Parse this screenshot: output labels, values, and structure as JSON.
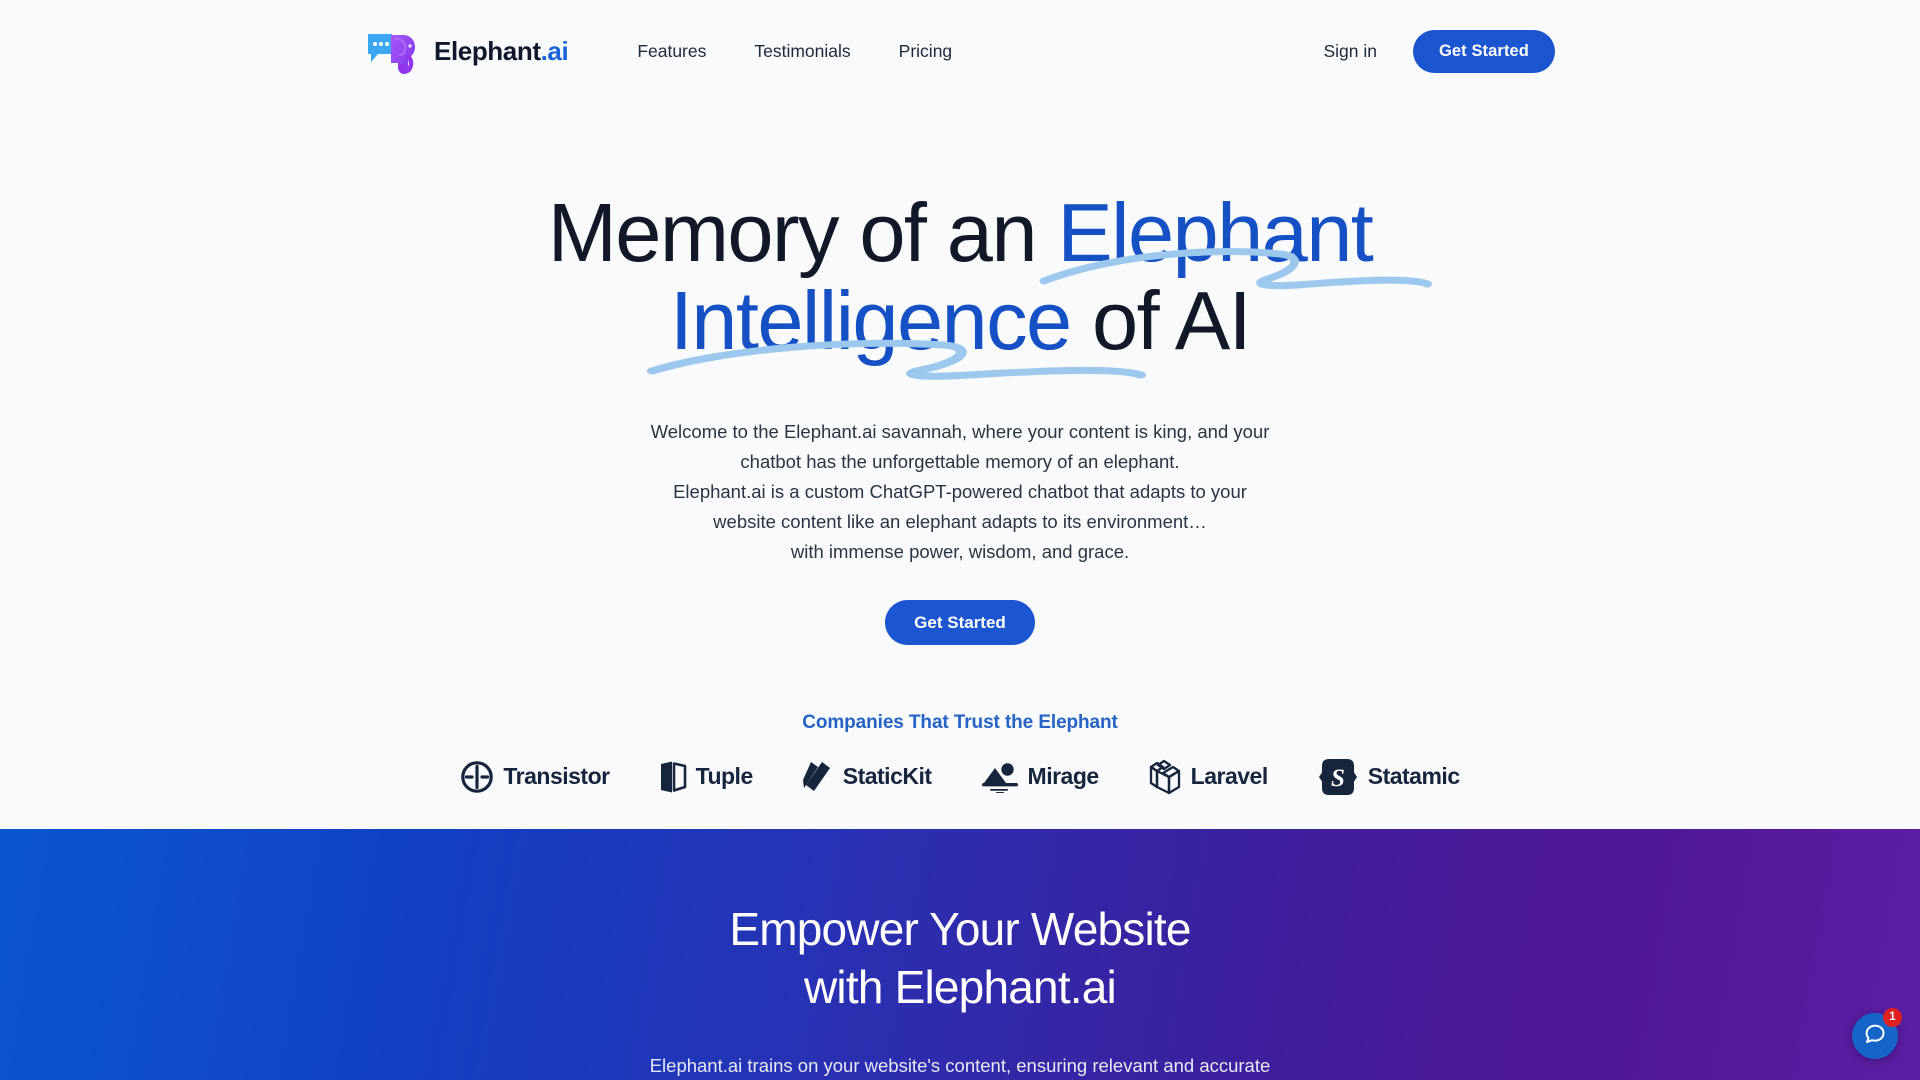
{
  "brand": {
    "name_main": "Elephant",
    "name_suffix": ".ai",
    "logo_icon": "chat-bubble-elephant-logo"
  },
  "nav": {
    "items": [
      {
        "label": "Features",
        "name": "nav-link-features"
      },
      {
        "label": "Testimonials",
        "name": "nav-link-testimonials"
      },
      {
        "label": "Pricing",
        "name": "nav-link-pricing"
      }
    ],
    "sign_in": "Sign in",
    "get_started": "Get Started"
  },
  "hero": {
    "line1_plain": "Memory of an ",
    "line1_highlight": "Elephant",
    "line2_highlight": "Intelligence",
    "line2_plain": " of AI",
    "paragraph_lines": [
      "Welcome to the Elephant.ai savannah, where your content is king, and your",
      "chatbot has the unforgettable memory of an elephant.",
      "Elephant.ai is a custom ChatGPT-powered chatbot that adapts to your",
      "website content like an elephant adapts to its environment…",
      "with immense power, wisdom, and grace."
    ],
    "cta_label": "Get Started",
    "trust_heading": "Companies That Trust the Elephant",
    "companies": [
      {
        "name": "Transistor",
        "icon": "transistor-logo-icon"
      },
      {
        "name": "Tuple",
        "icon": "tuple-logo-icon"
      },
      {
        "name": "StaticKit",
        "icon": "statickit-logo-icon"
      },
      {
        "name": "Mirage",
        "icon": "mirage-logo-icon"
      },
      {
        "name": "Laravel",
        "icon": "laravel-logo-icon"
      },
      {
        "name": "Statamic",
        "icon": "statamic-logo-icon"
      }
    ]
  },
  "empower": {
    "title_line1": "Empower Your Website",
    "title_line2": "with Elephant.ai",
    "subtitle_line1": "Elephant.ai trains on your website's content, ensuring relevant and accurate"
  },
  "chat_widget": {
    "icon": "chat-bubble-icon",
    "badge_count": "1"
  },
  "colors": {
    "primary_blue": "#1b55d0",
    "headline_blue": "#1551c4",
    "swoosh_blue": "#9dc8ee",
    "dark_text": "#111827",
    "page_bg": "#f8fafc",
    "gradient_start": "#0a56cf",
    "gradient_end": "#5a1ea4",
    "badge_red": "#e02020"
  }
}
